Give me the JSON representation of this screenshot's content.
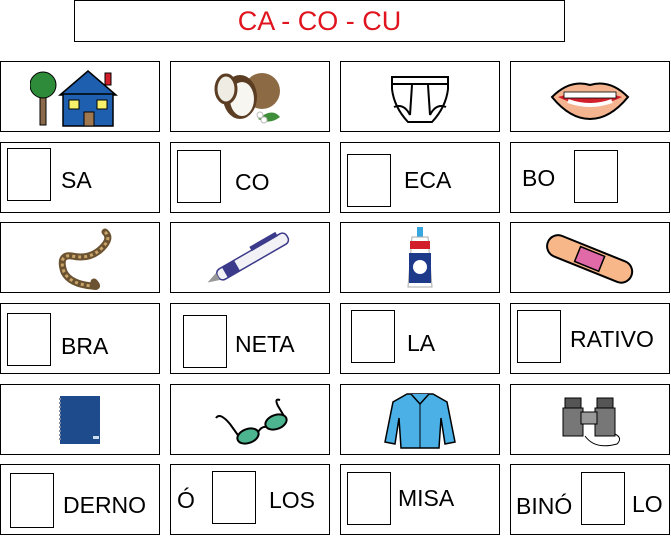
{
  "title": "CA - CO - CU",
  "colors": {
    "title": "#e0141e"
  },
  "rows": [
    {
      "pictures": [
        {
          "name": "house-icon",
          "label": "casa"
        },
        {
          "name": "coconut-icon",
          "label": "coco"
        },
        {
          "name": "underwear-icon",
          "label": "cueca"
        },
        {
          "name": "mouth-icon",
          "label": "boca"
        }
      ],
      "words": [
        {
          "before": "",
          "after": "SA"
        },
        {
          "before": "",
          "after": "CO"
        },
        {
          "before": "",
          "after": "ECA"
        },
        {
          "before": "BO",
          "after": ""
        }
      ]
    },
    {
      "pictures": [
        {
          "name": "snake-icon",
          "label": "cobra"
        },
        {
          "name": "pen-icon",
          "label": "caneta"
        },
        {
          "name": "glue-icon",
          "label": "cola"
        },
        {
          "name": "bandage-icon",
          "label": "curativo"
        }
      ],
      "words": [
        {
          "before": "",
          "after": "BRA"
        },
        {
          "before": "",
          "after": "NETA"
        },
        {
          "before": "",
          "after": "LA"
        },
        {
          "before": "",
          "after": "RATIVO"
        }
      ]
    },
    {
      "pictures": [
        {
          "name": "notebook-icon",
          "label": "caderno"
        },
        {
          "name": "glasses-icon",
          "label": "óculos"
        },
        {
          "name": "shirt-icon",
          "label": "camisa"
        },
        {
          "name": "binoculars-icon",
          "label": "binóculo"
        }
      ],
      "words": [
        {
          "before": "",
          "after": "DERNO"
        },
        {
          "before": "Ó",
          "after": "LOS"
        },
        {
          "before": "",
          "after": "MISA"
        },
        {
          "before": "BINÓ",
          "after": "LO"
        }
      ]
    }
  ]
}
